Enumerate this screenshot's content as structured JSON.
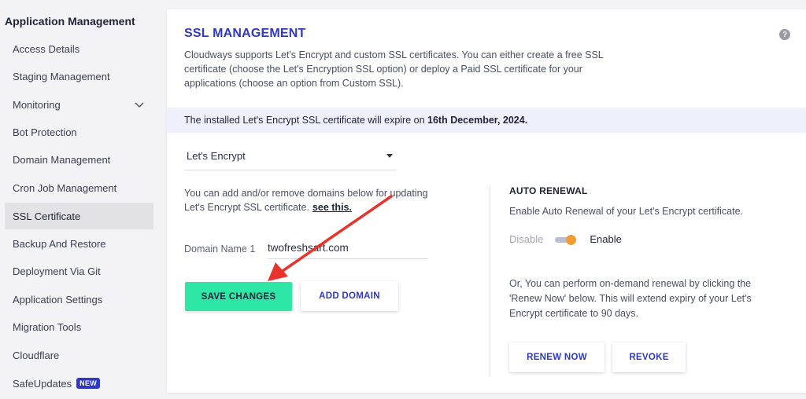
{
  "sidebar": {
    "title": "Application Management",
    "items": [
      {
        "label": "Access Details"
      },
      {
        "label": "Staging Management"
      },
      {
        "label": "Monitoring"
      },
      {
        "label": "Bot Protection"
      },
      {
        "label": "Domain Management"
      },
      {
        "label": "Cron Job Management"
      },
      {
        "label": "SSL Certificate"
      },
      {
        "label": "Backup And Restore"
      },
      {
        "label": "Deployment Via Git"
      },
      {
        "label": "Application Settings"
      },
      {
        "label": "Migration Tools"
      },
      {
        "label": "Cloudflare"
      },
      {
        "label": "SafeUpdates",
        "badge": "NEW"
      }
    ],
    "active": "SSL Certificate"
  },
  "ssl": {
    "title": "SSL MANAGEMENT",
    "help_icon": "?",
    "description": "Cloudways supports Let's Encrypt and custom SSL certificates. You can either create a free SSL certificate (choose the Let's Encryption SSL option) or deploy a Paid SSL certificate for your applications (choose an option from Custom SSL).",
    "notice_prefix": "The installed Let's Encrypt SSL certificate will expire on ",
    "notice_date": "16th December, 2024.",
    "provider_selected": "Let's Encrypt",
    "info_text": "You can add and/or remove domains below for updating Let's Encrypt SSL certificate.",
    "info_link": "see this.",
    "domain_label": "Domain Name 1",
    "domain_value": "twofreshsart.com",
    "save_button": "SAVE CHANGES",
    "add_domain_button": "ADD DOMAIN"
  },
  "auto_renewal": {
    "title": "AUTO RENEWAL",
    "description": "Enable Auto Renewal of your Let's Encrypt certificate.",
    "disable_label": "Disable",
    "enable_label": "Enable",
    "enabled": true,
    "note": "Or, You can perform on-demand renewal by clicking the 'Renew Now' below. This will extend expiry of your Let's Encrypt certificate to 90 days.",
    "renew_button": "RENEW NOW",
    "revoke_button": "REVOKE"
  },
  "colors": {
    "brand": "#2f39bf",
    "save_button": "#2ee6a6",
    "toggle_knob": "#f39c34",
    "annotation_arrow": "#e8322b"
  }
}
